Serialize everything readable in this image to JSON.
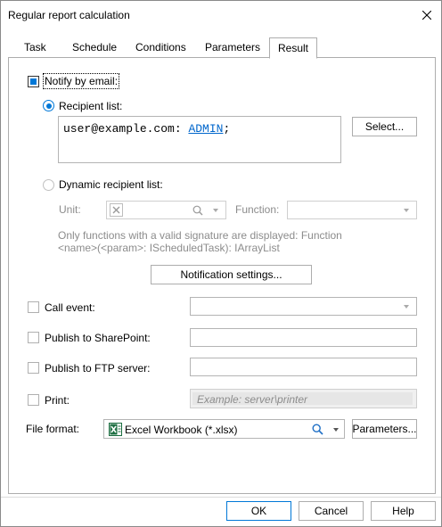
{
  "window": {
    "title": "Regular report calculation"
  },
  "tabs": [
    {
      "label": "Task"
    },
    {
      "label": "Schedule"
    },
    {
      "label": "Conditions"
    },
    {
      "label": "Parameters"
    },
    {
      "label": "Result"
    }
  ],
  "notify": {
    "label": "Notify by email:",
    "checked": true,
    "recipient_list_label": "Recipient list:",
    "recipient_address": "user@example.com:",
    "recipient_name": "ADMIN",
    "recipient_suffix": ";",
    "select_button": "Select...",
    "dynamic_label": "Dynamic recipient list:",
    "unit_label": "Unit:",
    "function_label": "Function:",
    "hint_line1": "Only functions with a valid signature are displayed: Function",
    "hint_line2": "<name>(<param>: IScheduledTask): IArrayList",
    "notification_settings_button": "Notification settings..."
  },
  "call_event": {
    "label": "Call event:",
    "value": ""
  },
  "sharepoint": {
    "label": "Publish to SharePoint:",
    "value": ""
  },
  "ftp": {
    "label": "Publish to FTP server:",
    "value": ""
  },
  "print": {
    "label": "Print:",
    "placeholder": "Example: server\\printer"
  },
  "file_format": {
    "label": "File format:",
    "value": "Excel Workbook (*.xlsx)",
    "parameters_button": "Parameters..."
  },
  "footer": {
    "ok": "OK",
    "cancel": "Cancel",
    "help": "Help"
  },
  "colors": {
    "accent": "#0078d7",
    "link": "#0066cc",
    "excel_green": "#1d6f42"
  },
  "icons": [
    "close-icon",
    "search-icon",
    "chevron-down-icon",
    "excel-icon",
    "clear-icon"
  ]
}
